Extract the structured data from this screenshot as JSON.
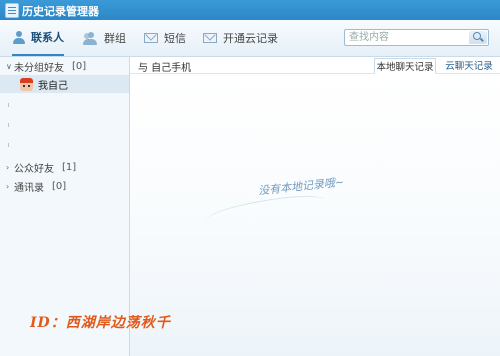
{
  "window": {
    "title": "历史记录管理器"
  },
  "tabs": [
    {
      "label": "联系人"
    },
    {
      "label": "群组"
    },
    {
      "label": "短信"
    },
    {
      "label": "开通云记录"
    }
  ],
  "search": {
    "placeholder": "查找内容"
  },
  "sidebar": {
    "groups": [
      {
        "arrow": "∨",
        "label": "未分组好友",
        "count": "[0]"
      },
      {
        "arrow": "›",
        "label": "公众好友",
        "count": "[1]"
      },
      {
        "arrow": "›",
        "label": "通讯录",
        "count": "[0]"
      }
    ],
    "contact": {
      "name": "我自己"
    }
  },
  "main": {
    "conversation_label": "与 自己手机",
    "tab_local": "本地聊天记录",
    "tab_cloud": "云聊天记录",
    "empty_text": "没有本地记录哦~"
  },
  "watermark": "ID：西湖岸边荡秋千",
  "colors": {
    "titlebar": "#2d86c6",
    "accent": "#2f86c8",
    "watermark": "#e15a1a"
  }
}
